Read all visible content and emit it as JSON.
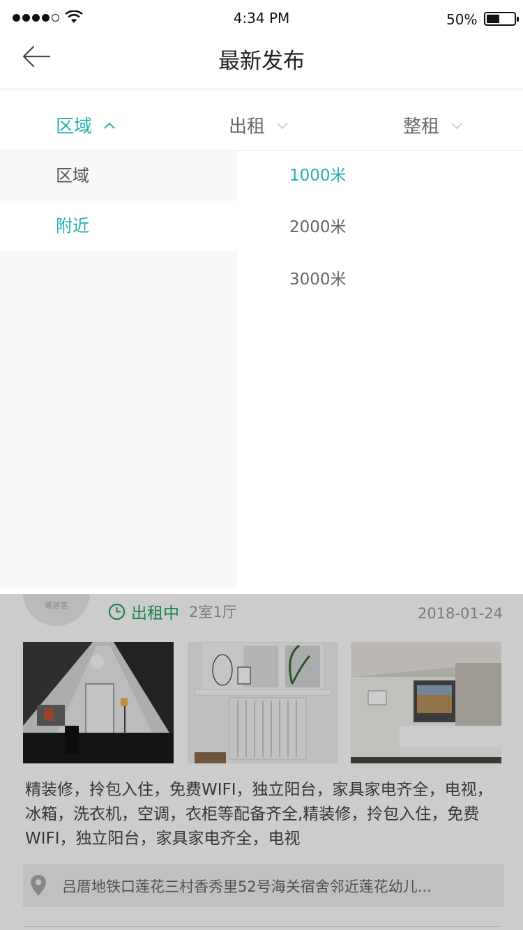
{
  "status_bar": {
    "time": "4:34 PM",
    "battery": "50%",
    "battery_level": 0.5
  },
  "nav": {
    "title": "最新发布"
  },
  "filter_tabs": [
    {
      "label": "区域",
      "active": true
    },
    {
      "label": "出租",
      "active": false
    },
    {
      "label": "整租",
      "active": false
    }
  ],
  "dropdown": {
    "left_items": [
      {
        "label": "区域",
        "active": false
      },
      {
        "label": "附近",
        "active": true
      }
    ],
    "right_items": [
      {
        "label": "1000米",
        "active": true
      },
      {
        "label": "2000米",
        "active": false
      },
      {
        "label": "3000米",
        "active": false
      }
    ]
  },
  "listing": {
    "avatar_text": "寄居客",
    "status": "出租中",
    "room_type": "2室1厅",
    "date": "2018-01-24",
    "photos": [
      "attic-office-photo",
      "radiator-window-photo",
      "hotel-bedroom-photo"
    ],
    "description": "精装修，拎包入住，免费WIFI，独立阳台，家具家电齐全，电视，冰箱，洗衣机，空调，衣柜等配备齐全,精装修，拎包入住，免费WIFI，独立阳台，家具家电齐全，电视",
    "address": "吕厝地铁口莲花三村香秀里52号海关宿舍邻近莲花幼儿..."
  },
  "colors": {
    "accent": "#26b0a8",
    "status_green": "#1ea55b",
    "overlay": "rgba(0,0,0,0.2)"
  }
}
